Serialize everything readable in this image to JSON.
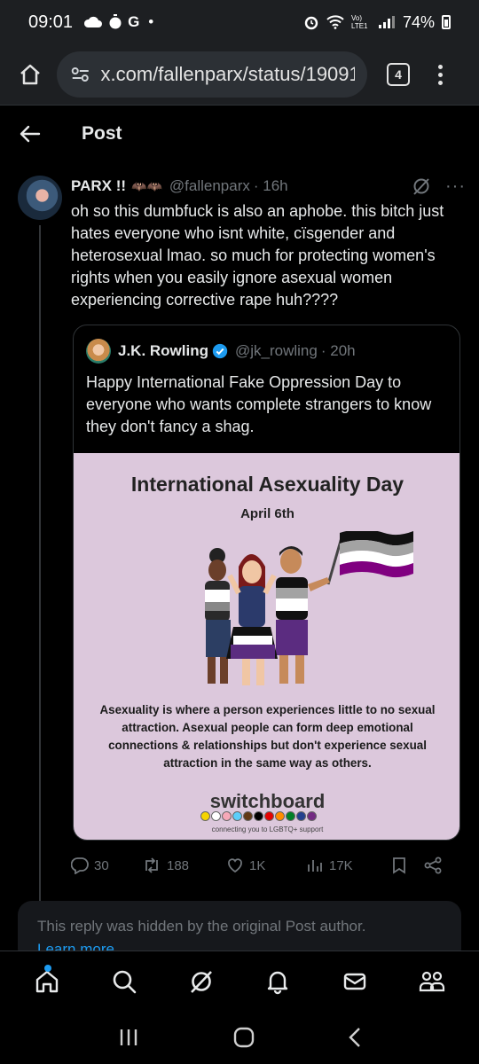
{
  "status_bar": {
    "time": "09:01",
    "g_label": "G",
    "dot": "•",
    "network": "Vo) LTE1",
    "battery": "74%",
    "icons": [
      "cloud-icon",
      "timer-icon",
      "google-icon",
      "alarm-icon",
      "wifi-icon",
      "signal-icon",
      "battery-icon"
    ]
  },
  "browser": {
    "url": "x.com/fallenparx/status/19091",
    "tab_count": "4",
    "icons": [
      "home-icon",
      "tune-icon",
      "more-vertical-icon"
    ]
  },
  "header": {
    "title": "Post"
  },
  "post": {
    "display_name": "PARX !!",
    "handle": "@fallenparx",
    "time": "· 16h",
    "text": "oh so this dumbfuck is also an aphobe. this bitch just hates everyone who isnt white, cïsgender and heterosexual lmao. so much for protecting women's rights when you easily ignore asexual women experiencing corrective rape huh????",
    "quote": {
      "display_name": "J.K. Rowling",
      "handle": "@jk_rowling",
      "time": "· 20h",
      "text": "Happy International Fake Oppression Day to everyone who wants complete strangers to know they don't fancy a shag.",
      "image": {
        "title": "International Asexuality Day",
        "date": "April 6th",
        "description": "Asexuality is where a person experiences little to no sexual attraction. Asexual people can form deep emotional connections & relationships but don't experience sexual attraction in the same way as others.",
        "brand": "switchboard",
        "brand_tagline": "connecting you to LGBTQ+ support",
        "brand_colors": [
          "#f5d400",
          "#ffffff",
          "#f7a8b8",
          "#5bcefa",
          "#613915",
          "#000000",
          "#e40303",
          "#ff8c00",
          "#008026",
          "#24408e",
          "#732982"
        ]
      }
    },
    "actions": {
      "replies": "30",
      "reposts": "188",
      "likes": "1K",
      "views": "17K"
    }
  },
  "hidden_reply": {
    "text": "This reply was hidden by the original Post author.",
    "link": "Learn more"
  },
  "bottom_nav": [
    "home-icon",
    "search-icon",
    "grok-icon",
    "notifications-icon",
    "messages-icon",
    "communities-icon"
  ],
  "android_nav": [
    "recents-icon",
    "home-icon",
    "back-icon"
  ],
  "colors": {
    "background": "#000000",
    "text": "#e7e9ea",
    "muted": "#71767b",
    "accent": "#1d9bf0",
    "border": "#2f3336"
  }
}
